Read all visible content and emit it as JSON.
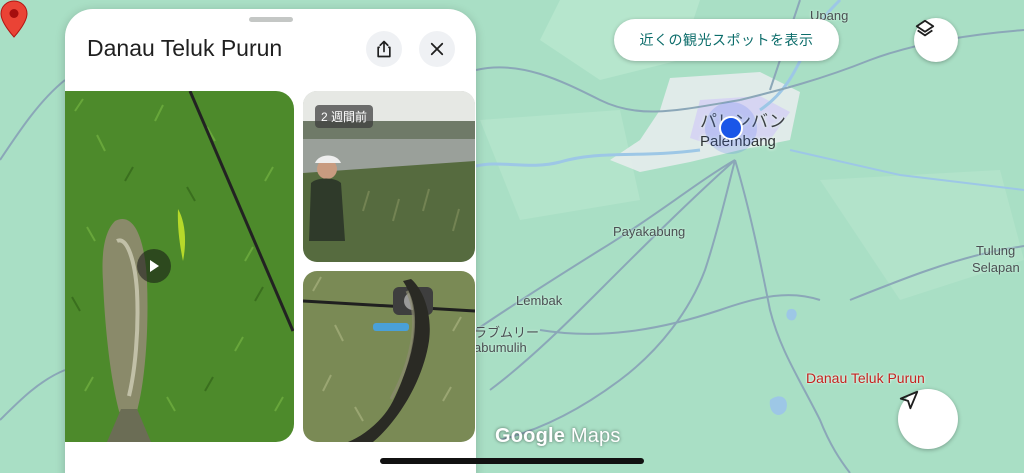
{
  "map": {
    "labels": {
      "upang": "Upang",
      "palembang_jp": "パレンバン",
      "palembang": "Palembang",
      "payakabung": "Payakabung",
      "tulung": "Tulung",
      "selapan": "Selapan",
      "lembak": "Lembak",
      "prabumulih_jp": "ラブムリー",
      "prabumulih": "abumulih"
    },
    "place_pin_label": "Danau Teluk Purun",
    "nearby_chip": "近くの観光スポットを表示",
    "logo": {
      "google": "Google",
      "maps": "Maps"
    },
    "colors": {
      "land": "#a9dfc5",
      "road": "#8ba7b8",
      "pin": "#ea4335",
      "location": "#1a56e8"
    }
  },
  "panel": {
    "title": "Danau Teluk Purun",
    "photos": {
      "recent_badge": "2 週間前"
    }
  },
  "icons": {
    "share": "share-icon",
    "close": "close-icon",
    "layers": "layers-icon",
    "navigate": "navigation-arrow-icon",
    "play": "play-icon",
    "pin": "map-pin-icon"
  }
}
